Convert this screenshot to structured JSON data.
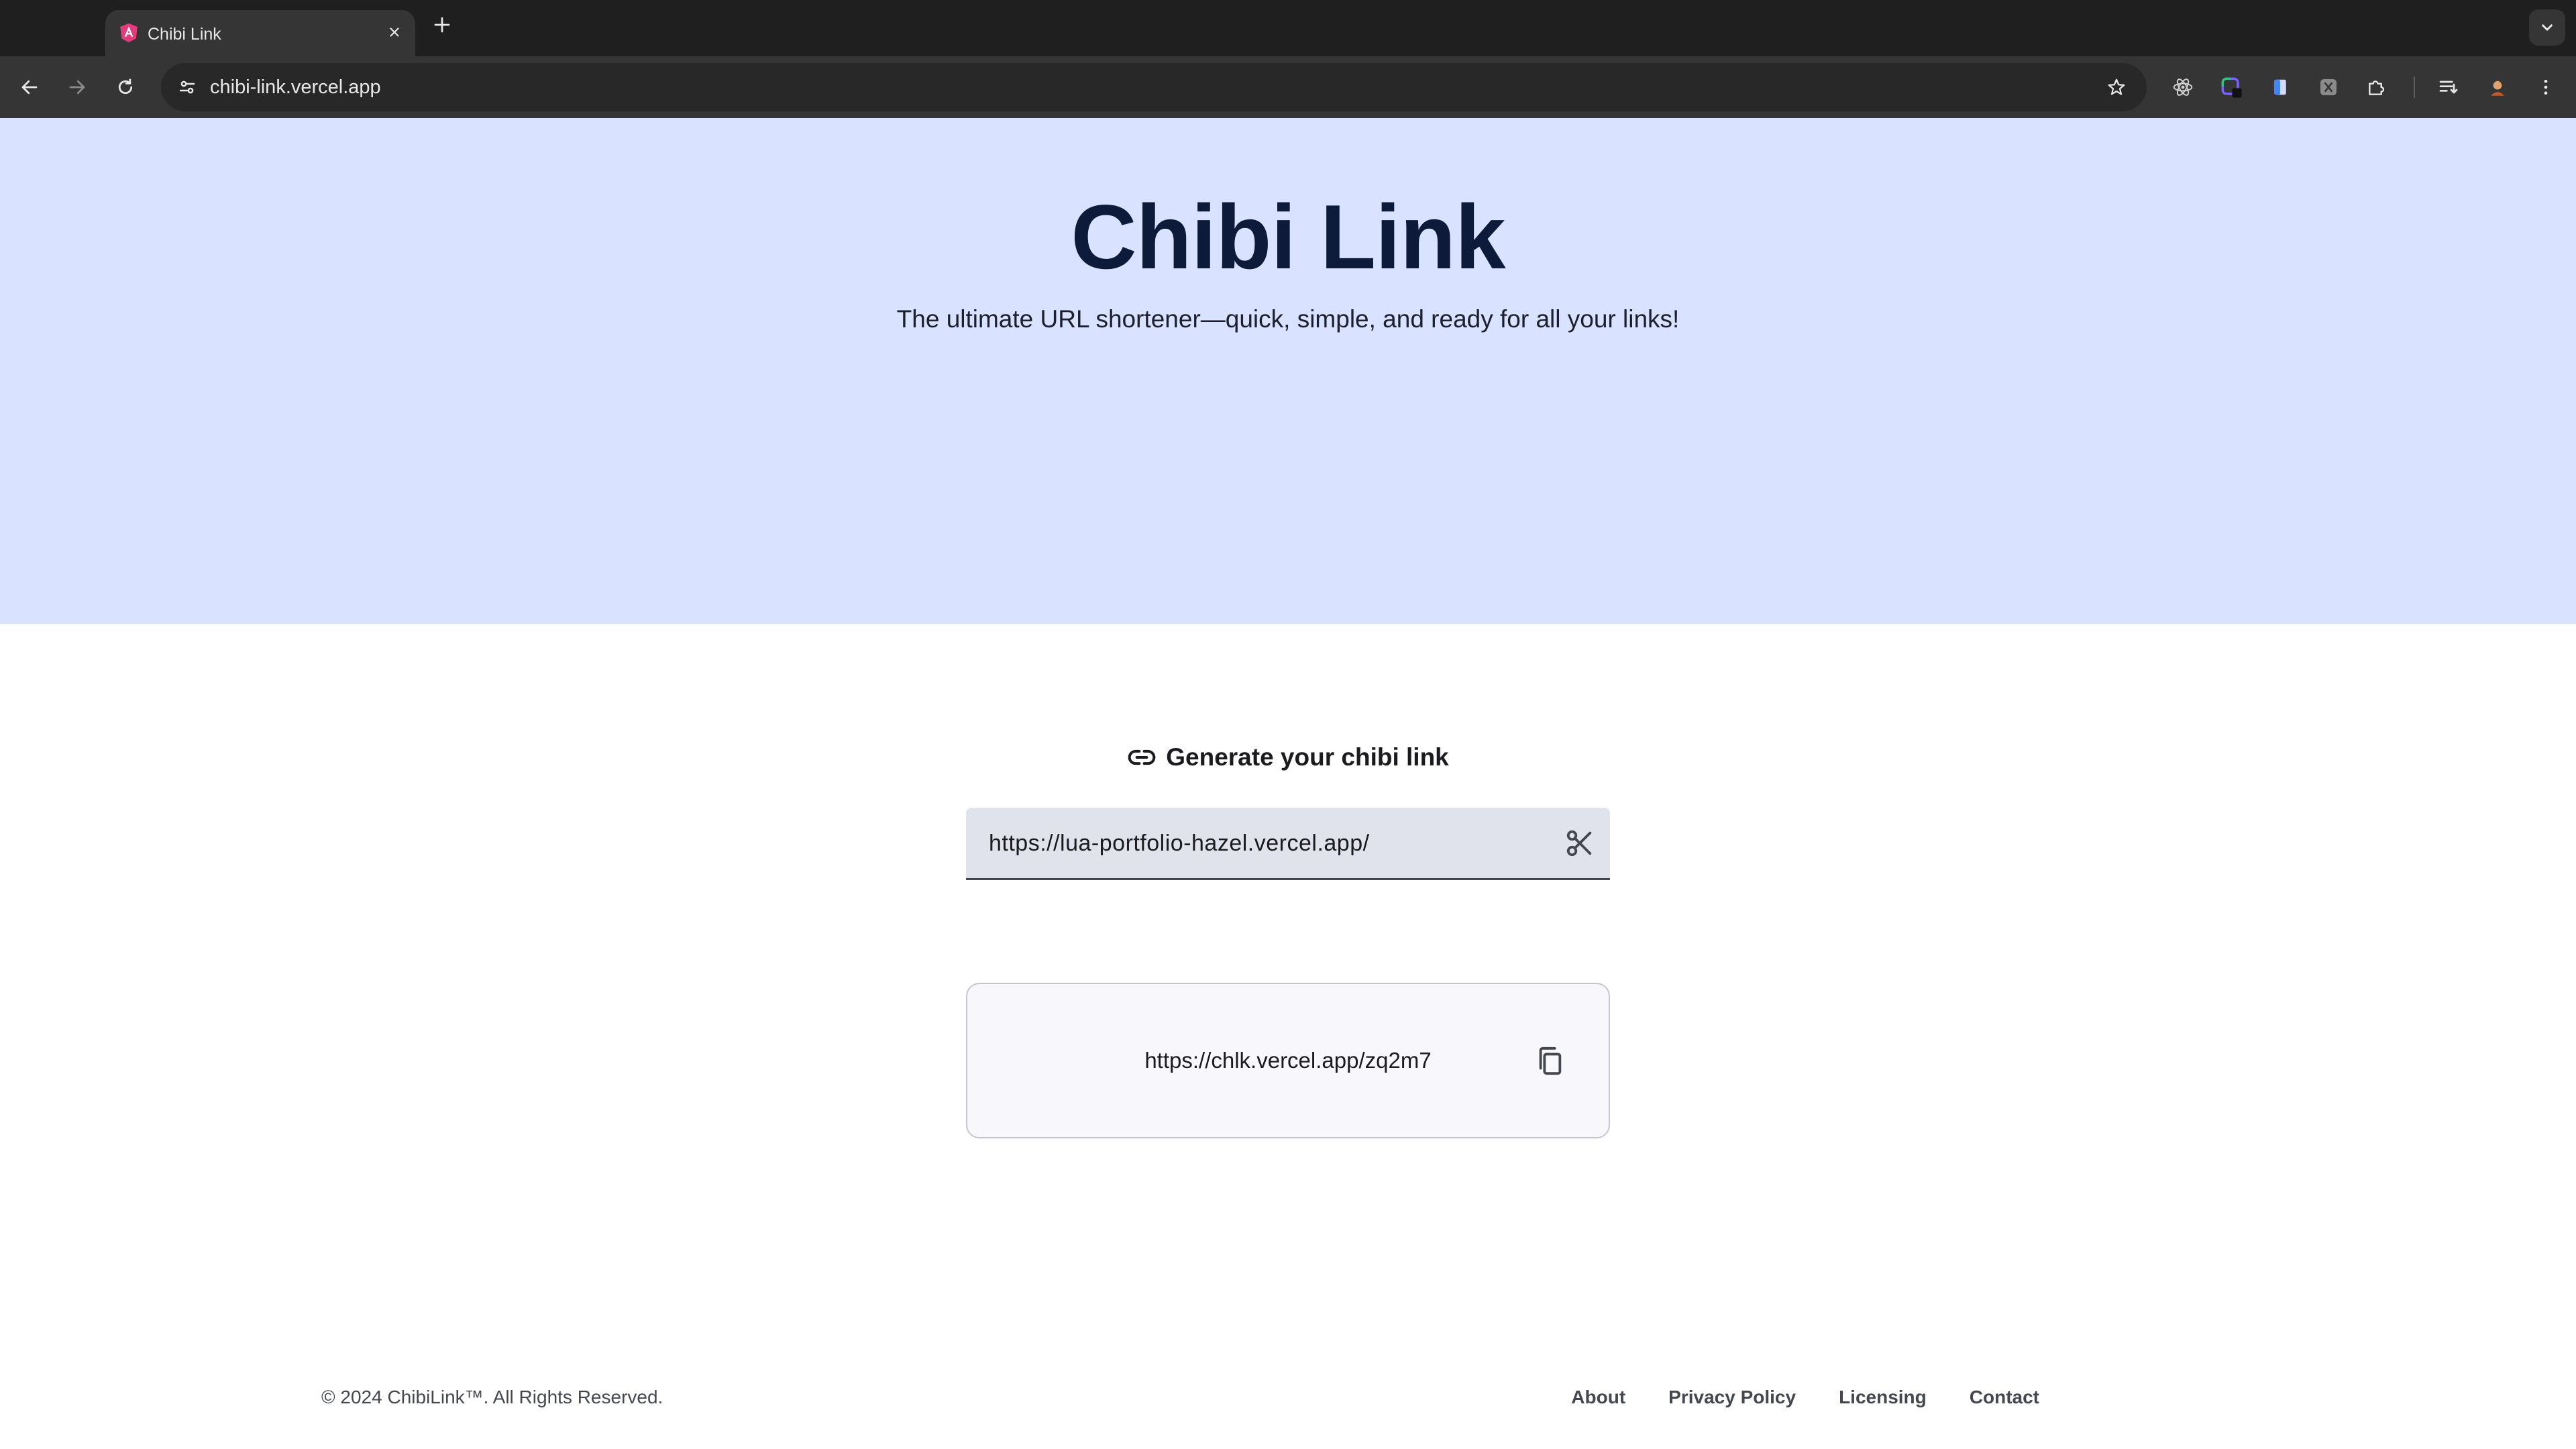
{
  "browser": {
    "tab": {
      "title": "Chibi Link",
      "favicon": "angular-a-icon"
    },
    "address_bar": {
      "url": "chibi-link.vercel.app"
    },
    "extensions": [
      "react-devtools-icon",
      "color-picker-icon",
      "document-icon",
      "grid-extension-icon",
      "puzzle-extensions-icon"
    ]
  },
  "hero": {
    "title": "Chibi Link",
    "subtitle": "The ultimate URL shortener—quick, simple, and ready for all your links!"
  },
  "generator": {
    "heading": "Generate your chibi link",
    "heading_icon": "link-icon",
    "input_value": "https://lua-portfolio-hazel.vercel.app/",
    "action_icon": "scissors-icon"
  },
  "result": {
    "short_url": "https://chlk.vercel.app/zq2m7",
    "copy_icon": "copy-icon"
  },
  "footer": {
    "copyright": "© 2024 ChibiLink™. All Rights Reserved.",
    "links": [
      "About",
      "Privacy Policy",
      "Licensing",
      "Contact"
    ]
  },
  "colors": {
    "hero_background": "#d9e2fe",
    "title_color": "#0e1a3a",
    "input_background": "#e0e2ec",
    "card_background": "#f8f8fc"
  }
}
